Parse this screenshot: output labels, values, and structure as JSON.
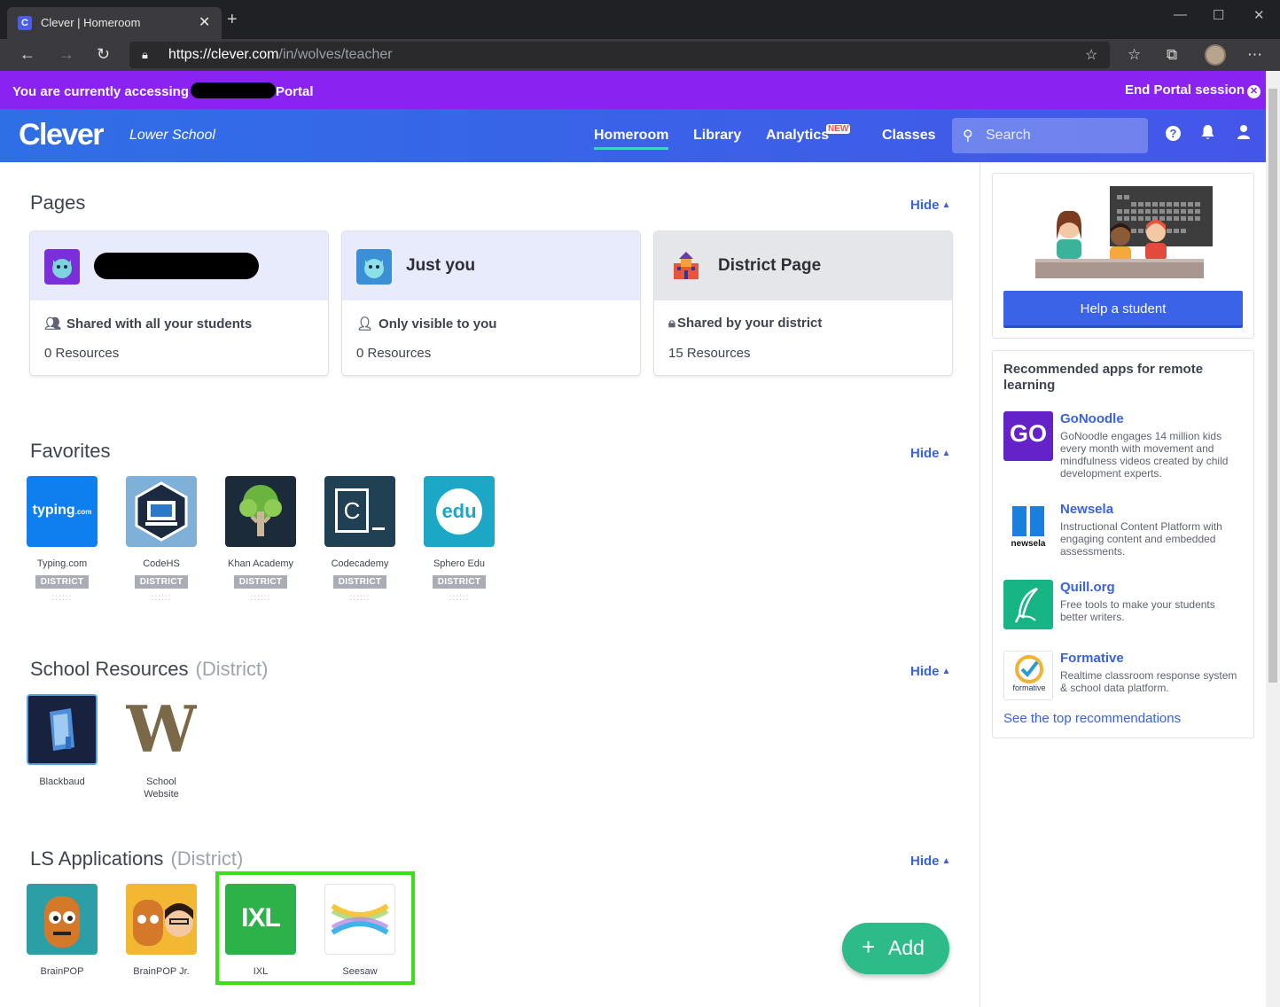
{
  "browser": {
    "tab_title": "Clever | Homeroom",
    "url_host": "https://clever.com",
    "url_path": "/in/wolves/teacher"
  },
  "portal_bar": {
    "prefix": "You are currently accessing",
    "suffix": "Portal",
    "end_label": "End Portal session"
  },
  "header": {
    "logo": "Clever",
    "school": "Lower School",
    "nav": [
      "Homeroom",
      "Library",
      "Analytics",
      "Classes"
    ],
    "analytics_badge": "NEW",
    "search_placeholder": "Search"
  },
  "pages": {
    "title": "Pages",
    "hide_label": "Hide",
    "cards": [
      {
        "title": "",
        "share": "Shared with all your students",
        "resources": "0 Resources"
      },
      {
        "title": "Just you",
        "share": "Only visible to you",
        "resources": "0 Resources"
      },
      {
        "title": "District Page",
        "share": "Shared by your district",
        "resources": "15 Resources"
      }
    ]
  },
  "favorites": {
    "title": "Favorites",
    "hide_label": "Hide",
    "apps": [
      {
        "name": "Typing.com",
        "badge": "DISTRICT"
      },
      {
        "name": "CodeHS",
        "badge": "DISTRICT"
      },
      {
        "name": "Khan Academy",
        "badge": "DISTRICT"
      },
      {
        "name": "Codecademy",
        "badge": "DISTRICT"
      },
      {
        "name": "Sphero Edu",
        "badge": "DISTRICT"
      }
    ],
    "grip": "::::::"
  },
  "school_resources": {
    "title": "School Resources",
    "sub": "(District)",
    "hide_label": "Hide",
    "apps": [
      {
        "name": "Blackbaud"
      },
      {
        "name": "School Website"
      }
    ]
  },
  "ls_apps": {
    "title": "LS Applications",
    "sub": "(District)",
    "hide_label": "Hide",
    "apps": [
      {
        "name": "BrainPOP"
      },
      {
        "name": "BrainPOP Jr."
      },
      {
        "name": "IXL"
      },
      {
        "name": "Seesaw"
      }
    ]
  },
  "add_button": {
    "label": "Add"
  },
  "help_card": {
    "button": "Help a student"
  },
  "recommended": {
    "title": "Recommended apps for remote learning",
    "items": [
      {
        "name": "GoNoodle",
        "desc": "GoNoodle engages 14 million kids every month with movement and mindfulness videos created by child development experts."
      },
      {
        "name": "Newsela",
        "desc": "Instructional Content Platform with engaging content and embedded assessments."
      },
      {
        "name": "Quill.org",
        "desc": "Free tools to make your students better writers."
      },
      {
        "name": "Formative",
        "desc": "Realtime classroom response system & school data platform."
      }
    ],
    "link": "See the top recommendations"
  },
  "icon_text": {
    "typing": "typing",
    "typing_com": ".com",
    "codecademy": "C",
    "sphero": "edu",
    "school_website": "W",
    "ixl": "IXL",
    "gonoodle": "GO",
    "newsela": "newsela",
    "formative": "formative"
  },
  "colors": {
    "portal": "#8a22f2",
    "header": "#3a62e8",
    "accent": "#3a63d8",
    "add": "#2dbb8a",
    "highlight": "#39e01a"
  }
}
